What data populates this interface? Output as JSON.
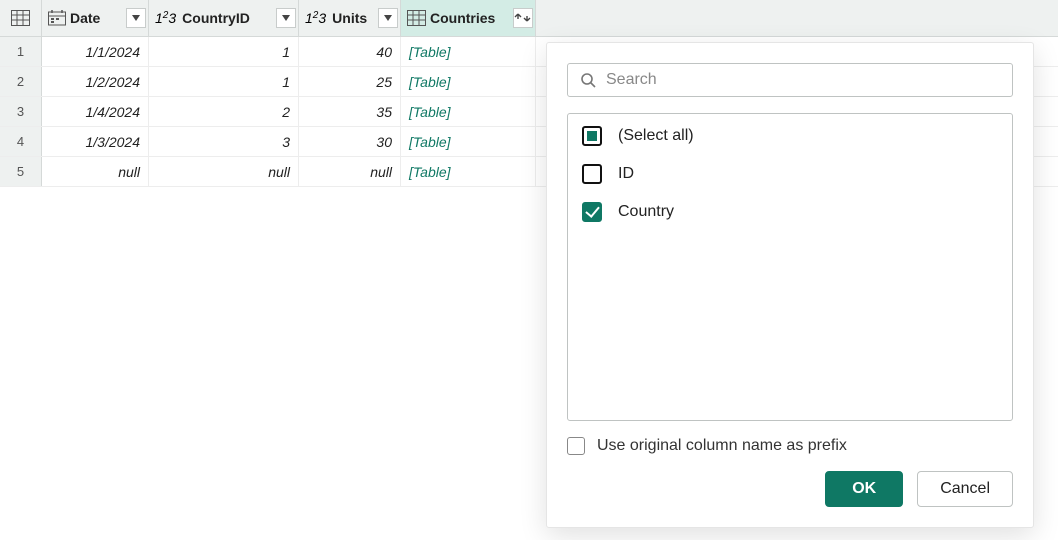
{
  "columns": {
    "date": {
      "name": "Date"
    },
    "country": {
      "name": "CountryID"
    },
    "units": {
      "name": "Units"
    },
    "ctry": {
      "name": "Countries"
    }
  },
  "rows": [
    {
      "num": "1",
      "date": "1/1/2024",
      "cid": "1",
      "units": "40",
      "ctry": "[Table]"
    },
    {
      "num": "2",
      "date": "1/2/2024",
      "cid": "1",
      "units": "25",
      "ctry": "[Table]"
    },
    {
      "num": "3",
      "date": "1/4/2024",
      "cid": "2",
      "units": "35",
      "ctry": "[Table]"
    },
    {
      "num": "4",
      "date": "1/3/2024",
      "cid": "3",
      "units": "30",
      "ctry": "[Table]"
    },
    {
      "num": "5",
      "date": "null",
      "cid": "null",
      "units": "null",
      "ctry": "[Table]"
    }
  ],
  "popup": {
    "search_placeholder": "Search",
    "select_all": "(Select all)",
    "option_id": "ID",
    "option_country": "Country",
    "prefix_label": "Use original column name as prefix",
    "ok": "OK",
    "cancel": "Cancel"
  }
}
